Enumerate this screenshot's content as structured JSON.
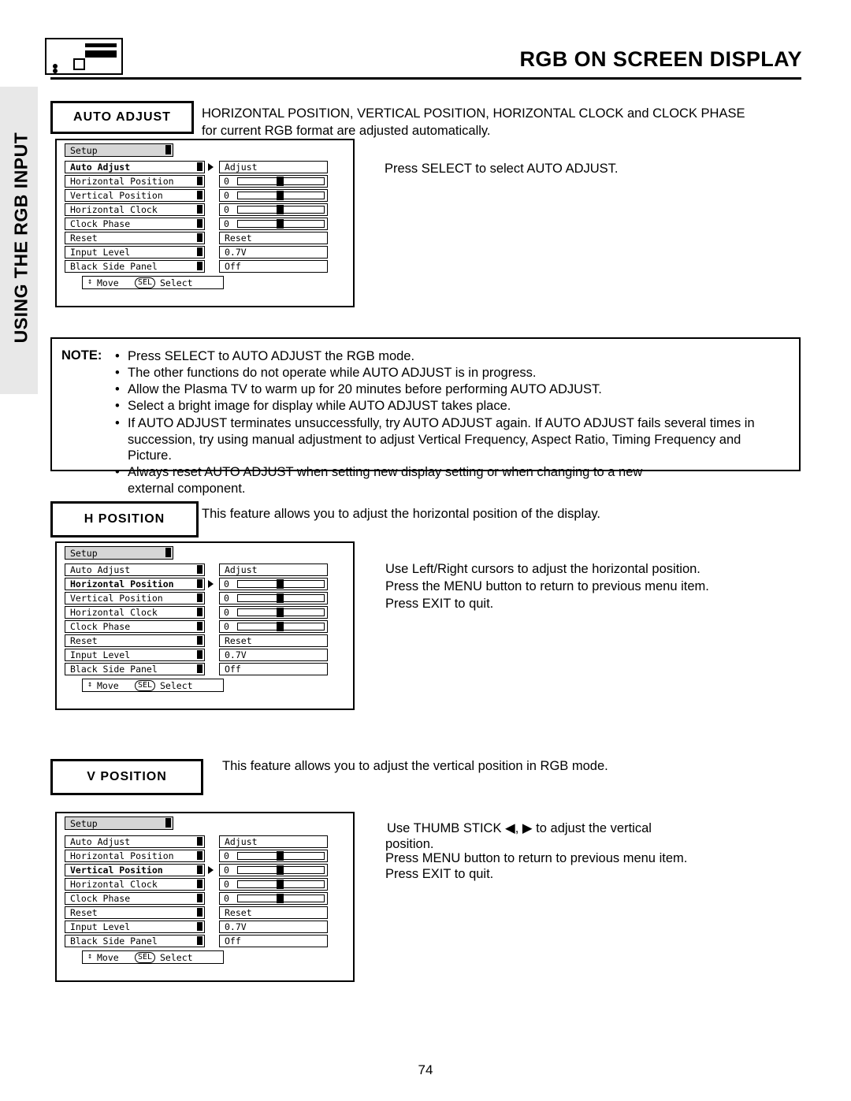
{
  "header": {
    "title": "RGB ON SCREEN DISPLAY",
    "device_icon": "plasma-tv-icon"
  },
  "sidebar": {
    "label": "USING THE RGB INPUT"
  },
  "sections": {
    "auto_adjust": {
      "heading": "AUTO ADJUST",
      "desc_line1": "HORIZONTAL POSITION, VERTICAL POSITION, HORIZONTAL CLOCK and CLOCK PHASE",
      "desc_line2": "for current RGB format are adjusted automatically.",
      "instruction": "Press SELECT to select AUTO ADJUST."
    },
    "h_position": {
      "heading": "H POSITION",
      "desc": "This feature allows you to adjust the horizontal position of the display.",
      "instr_line1": "Use Left/Right cursors to adjust the horizontal position.",
      "instr_line2": "Press the MENU button to return to previous menu item.",
      "instr_line3": "Press EXIT to quit."
    },
    "v_position": {
      "heading": "V POSITION",
      "desc": "This feature allows you to adjust the vertical position in RGB mode.",
      "instr_line1": "Use THUMB STICK ◀, ▶ to adjust the vertical",
      "instr_line2": "position.",
      "instr_line3": "Press MENU button to return to previous menu item.",
      "instr_line4": "Press EXIT to quit."
    }
  },
  "note": {
    "label": "NOTE:",
    "items": [
      "Press SELECT to AUTO ADJUST the RGB mode.",
      "The other functions do not operate while AUTO ADJUST is in progress.",
      "Allow the Plasma TV to warm up for 20 minutes before performing AUTO ADJUST.",
      "Select a bright image for display while AUTO ADJUST takes place.",
      "If AUTO ADJUST terminates unsuccessfully, try AUTO ADJUST again.  If AUTO ADJUST fails several times in",
      "succession, try using manual adjustment to adjust Vertical Frequency, Aspect Ratio, Timing Frequency and Picture.",
      "Always reset AUTO ADJUST when setting new display setting or when changing to a new",
      "external component."
    ]
  },
  "osd": {
    "title": "Setup",
    "labels": {
      "auto_adjust": "Auto Adjust",
      "horizontal_position": "Horizontal Position",
      "vertical_position": "Vertical Position",
      "horizontal_clock": "Horizontal Clock",
      "clock_phase": "Clock Phase",
      "reset": "Reset",
      "input_level": "Input Level",
      "black_side_panel": "Black Side Panel"
    },
    "values": {
      "adjust": "Adjust",
      "zero": "0",
      "reset": "Reset",
      "input_level": "0.7V",
      "black_side_panel": "Off"
    },
    "footer": {
      "move": "Move",
      "sel_key": "SEL",
      "select": "Select",
      "updown_icon": "up-down-arrow-icon"
    }
  },
  "page_number": "74"
}
